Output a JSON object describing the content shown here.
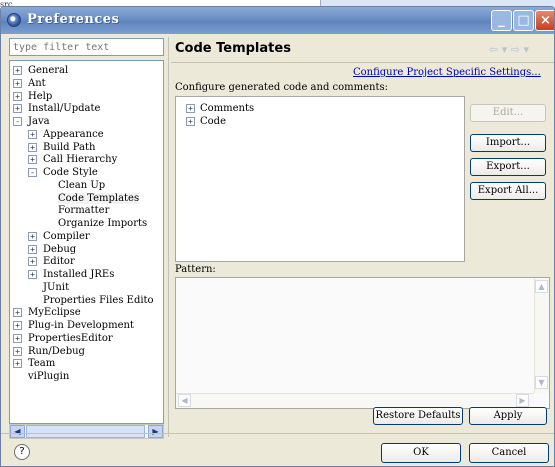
{
  "background": {
    "project_label": "src"
  },
  "window": {
    "title": "Preferences",
    "accent": "#6a8ec5",
    "link_color": "#0000b3"
  },
  "left": {
    "filter_placeholder": "type filter text",
    "tree": [
      {
        "label": "General",
        "expander": "+"
      },
      {
        "label": "Ant",
        "expander": "+"
      },
      {
        "label": "Help",
        "expander": "+"
      },
      {
        "label": "Install/Update",
        "expander": "+"
      },
      {
        "label": "Java",
        "expander": "-"
      },
      {
        "label": "Appearance",
        "expander": "+"
      },
      {
        "label": "Build Path",
        "expander": "+"
      },
      {
        "label": "Call Hierarchy",
        "expander": "+"
      },
      {
        "label": "Code Style",
        "expander": "-"
      },
      {
        "label": "Clean Up",
        "expander": ""
      },
      {
        "label": "Code Templates",
        "expander": ""
      },
      {
        "label": "Formatter",
        "expander": ""
      },
      {
        "label": "Organize Imports",
        "expander": ""
      },
      {
        "label": "Compiler",
        "expander": "+"
      },
      {
        "label": "Debug",
        "expander": "+"
      },
      {
        "label": "Editor",
        "expander": "+"
      },
      {
        "label": "Installed JREs",
        "expander": "+"
      },
      {
        "label": "JUnit",
        "expander": ""
      },
      {
        "label": "Properties Files Edito",
        "expander": ""
      },
      {
        "label": "MyEclipse",
        "expander": "+"
      },
      {
        "label": "Plug-in Development",
        "expander": "+"
      },
      {
        "label": "PropertiesEditor",
        "expander": "+"
      },
      {
        "label": "Run/Debug",
        "expander": "+"
      },
      {
        "label": "Team",
        "expander": "+"
      },
      {
        "label": "viPlugin",
        "expander": ""
      }
    ]
  },
  "right": {
    "page_title": "Code Templates",
    "nav_back": "⇦ ▾",
    "nav_forward": "⇨ ▾",
    "configure_specific_link": "Configure Project Specific Settings...",
    "configure_label": "Configure generated code and comments:",
    "template_tree": [
      {
        "label": "Comments",
        "expander": "+"
      },
      {
        "label": "Code",
        "expander": "+"
      }
    ],
    "buttons": {
      "edit": "Edit...",
      "import": "Import...",
      "export": "Export...",
      "export_all": "Export All..."
    },
    "pattern_label": "Pattern:",
    "pattern_text": "",
    "restore_defaults": "Restore Defaults",
    "apply": "Apply"
  },
  "footer": {
    "help_glyph": "?",
    "ok": "OK",
    "cancel": "Cancel"
  }
}
